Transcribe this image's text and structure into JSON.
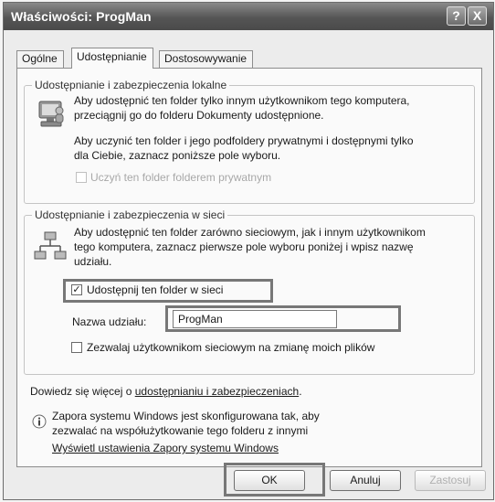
{
  "window": {
    "title": "Właściwości: ProgMan",
    "help_btn": "?",
    "close_btn": "X"
  },
  "tabs": [
    "Ogólne",
    "Udostępnianie",
    "Dostosowywanie"
  ],
  "local_group": {
    "legend": "Udostępnianie i zabezpieczenia lokalne",
    "text1_line1": "Aby udostępnić ten folder tylko innym użytkownikom tego komputera,",
    "text1_line2": "przeciągnij go do folderu Dokumenty udostępnione.",
    "text2_line1": "Aby uczynić ten folder i jego podfoldery prywatnymi i dostępnymi tylko",
    "text2_line2": "dla Ciebie, zaznacz poniższe pole wyboru.",
    "private_label": "Uczyń ten folder folderem prywatnym"
  },
  "network_group": {
    "legend": "Udostępnianie i zabezpieczenia w sieci",
    "text_line1": "Aby udostępnić ten folder zarówno sieciowym, jak i innym użytkownikom",
    "text_line2": "tego komputera, zaznacz pierwsze pole wyboru poniżej i wpisz nazwę",
    "text_line3": "udziału.",
    "share_label": "Udostępnij ten folder w sieci",
    "share_checked": true,
    "share_name_label": "Nazwa udziału:",
    "share_name_value": "ProgMan",
    "allow_change_label": "Zezwalaj użytkownikom sieciowym na zmianę moich plików",
    "allow_change_checked": false
  },
  "learn_more": {
    "prefix": "Dowiedz się więcej o ",
    "link": "udostępnianiu i zabezpieczeniach",
    "suffix": "."
  },
  "firewall": {
    "line1": "Zapora systemu Windows jest skonfigurowana tak, aby",
    "line2": "zezwalać na współużytkowanie tego folderu z innymi",
    "link": "Wyświetl ustawienia Zapory systemu Windows"
  },
  "buttons": {
    "ok": "OK",
    "cancel": "Anuluj",
    "apply": "Zastosuj"
  }
}
